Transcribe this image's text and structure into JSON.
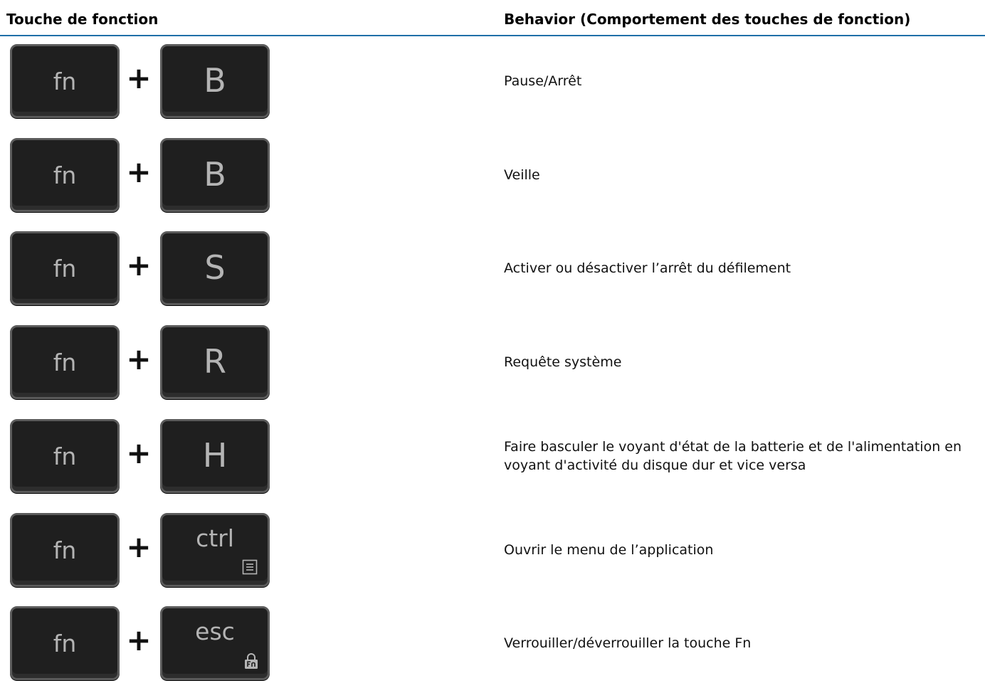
{
  "header": {
    "col1": "Touche de fonction",
    "col2": "Behavior (Comportement des touches de fonction)"
  },
  "plus_sign": "+",
  "rows": [
    {
      "key1": "fn",
      "key2": "B",
      "behavior": "Pause/Arrêt"
    },
    {
      "key1": "fn",
      "key2": "B",
      "behavior": "Veille"
    },
    {
      "key1": "fn",
      "key2": "S",
      "behavior": "Activer ou désactiver l’arrêt du défilement"
    },
    {
      "key1": "fn",
      "key2": "R",
      "behavior": "Requête système"
    },
    {
      "key1": "fn",
      "key2": "H",
      "behavior": "Faire basculer le voyant d'état de la batterie et de l'alimentation en voyant d'activité du disque dur et vice versa"
    },
    {
      "key1": "fn",
      "key2": "ctrl",
      "key2_icon": "menu-icon",
      "behavior": "Ouvrir le menu de l’application"
    },
    {
      "key1": "fn",
      "key2": "esc",
      "key2_icon": "fn-lock-icon",
      "behavior": "Verrouiller/déverrouiller la touche Fn"
    }
  ],
  "colors": {
    "rule": "#1f6fa8",
    "key_face": "#1f1f1f",
    "key_border": "#5b5b5b",
    "key_label": "#b4b4b4"
  }
}
